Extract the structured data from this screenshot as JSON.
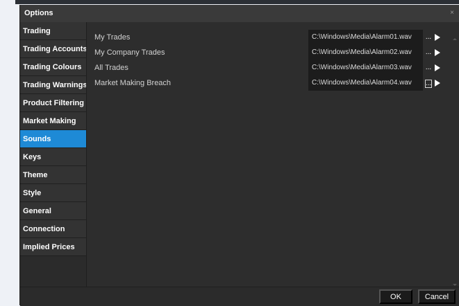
{
  "window": {
    "title": "Options",
    "close_glyph": "×"
  },
  "sidebar": {
    "items": [
      {
        "label": "Trading",
        "active": false
      },
      {
        "label": "Trading Accounts",
        "active": false
      },
      {
        "label": "Trading Colours",
        "active": false
      },
      {
        "label": "Trading Warnings",
        "active": false
      },
      {
        "label": "Product Filtering",
        "active": false
      },
      {
        "label": "Market Making",
        "active": false
      },
      {
        "label": "Sounds",
        "active": true
      },
      {
        "label": "Keys",
        "active": false
      },
      {
        "label": "Theme",
        "active": false
      },
      {
        "label": "Style",
        "active": false
      },
      {
        "label": "General",
        "active": false
      },
      {
        "label": "Connection",
        "active": false
      },
      {
        "label": "Implied Prices",
        "active": false
      }
    ]
  },
  "sounds": {
    "rows": [
      {
        "label": "My Trades",
        "path": "C:\\Windows\\Media\\Alarm01.wav",
        "browse": "..."
      },
      {
        "label": "My Company Trades",
        "path": "C:\\Windows\\Media\\Alarm02.wav",
        "browse": "..."
      },
      {
        "label": "All Trades",
        "path": "C:\\Windows\\Media\\Alarm03.wav",
        "browse": "..."
      },
      {
        "label": "Market Making Breach",
        "path": "C:\\Windows\\Media\\Alarm04.wav",
        "browse": "..."
      }
    ]
  },
  "footer": {
    "ok_label": "OK",
    "cancel_label": "Cancel"
  },
  "colors": {
    "accent": "#1e8ad6",
    "background": "#2b2b2b"
  }
}
